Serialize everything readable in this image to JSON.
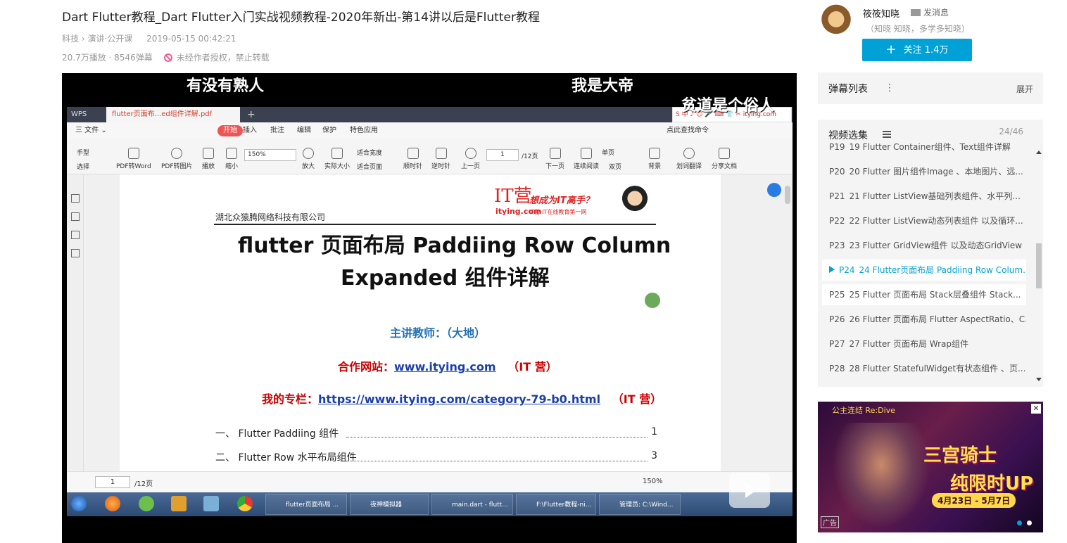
{
  "title": "Dart Flutter教程_Dart Flutter入门实战视频教程-2020年新出-第14讲以后是Flutter教程",
  "meta": {
    "category": "科技",
    "sub": "演讲·公开课",
    "date": "2019-05-15 00:42:21",
    "plays": "20.7万播放 · 8546弹幕",
    "notice": "未经作者授权，禁止转载"
  },
  "up": {
    "name": "筱筱知晓",
    "message": "发消息",
    "sign": "（知晓 知晓，多学多知晓）",
    "follow": "关注 1.4万",
    "follow_plus": "+"
  },
  "danmu_panel": {
    "title": "弹幕列表",
    "dots": "⋮",
    "expand": "展开"
  },
  "playlist": {
    "title": "视频选集",
    "count": "24/46",
    "items": [
      {
        "p": "P19",
        "label": "19 Flutter Container组件、Text组件详解"
      },
      {
        "p": "P20",
        "label": "20 Flutter 图片组件Image 、本地图片、远..."
      },
      {
        "p": "P21",
        "label": "21 Flutter ListView基础列表组件、水平列..."
      },
      {
        "p": "P22",
        "label": "22 Flutter ListView动态列表组件 以及循环..."
      },
      {
        "p": "P23",
        "label": "23 Flutter GridView组件 以及动态GridView"
      },
      {
        "p": "P24",
        "label": "24 Flutter页面布局 Paddiing Row Colum..."
      },
      {
        "p": "P25",
        "label": "25 Flutter 页面布局 Stack层叠组件 Stack..."
      },
      {
        "p": "P26",
        "label": "26 Flutter 页面布局 Flutter AspectRatio、C..."
      },
      {
        "p": "P27",
        "label": "27 Flutter 页面布局 Wrap组件"
      },
      {
        "p": "P28",
        "label": "28 Flutter StatefulWidget有状态组件 、页..."
      }
    ]
  },
  "ad": {
    "brand": "公主连结 Re:Dive",
    "line1": "三宫骑士",
    "line2": "纯限时UP",
    "date": "4月23日 - 5月7日",
    "tag": "广告",
    "close": "✕"
  },
  "danmaku": [
    "有没有熟人",
    "我是大帝",
    "贫道是个俗人"
  ],
  "wps": {
    "tab_app": "WPS",
    "tab_doc": "flutter页面布...ed组件详解.pdf",
    "tab_plus": "+",
    "menu": [
      "三 文件 ⌄",
      "开始",
      "插入",
      "批注",
      "编辑",
      "保护",
      "特色应用",
      "点此查找命令"
    ],
    "tools": [
      "手型",
      "选择",
      "PDF转Word",
      "PDF转图片",
      "播放",
      "缩小",
      "放大",
      "实际大小",
      "适合宽度",
      "适合页面",
      "顺时针",
      "逆时针",
      "上一页",
      "下一页",
      "连续阅读",
      "单页",
      "双页",
      "背景",
      "划词翻译",
      "分享文档"
    ],
    "zoom": "150%",
    "page": "1",
    "page_total": "/12页",
    "status_zoom": "150%",
    "ime": "S 中 ♪ ☺ 🎤 ⌨ 👕 ✂",
    "ime_site": "itying.com"
  },
  "doc": {
    "org": "湖北众猿腾网络科技有限公司",
    "it_logo": "IT营",
    "it_site": "itying.com",
    "slogan": "想成为IT高手？",
    "slogan2": "IT营-IT在线教育第一网",
    "h1": "flutter 页面布局  Paddiing Row Column",
    "h2": "Expanded 组件详解",
    "teacher": "主讲教师：（大地）",
    "site_label": "合作网站：",
    "site_url": "www.itying.com",
    "site_tail": "（IT 营）",
    "col_label": "我的专栏：",
    "col_url": "https://www.itying.com/category-79-b0.html",
    "col_tail": "（IT 营）",
    "toc": [
      {
        "label": "一、   Flutter Paddiing 组件",
        "page": "1"
      },
      {
        "label": "二、   Flutter Row 水平布局组件",
        "page": "3"
      }
    ]
  },
  "taskbar": [
    "flutter页面布局 ...",
    "夜神模拟器",
    "main.dart - flutt...",
    "F:\\Flutter教程-ni...",
    "管理员: C:\\Wind..."
  ]
}
